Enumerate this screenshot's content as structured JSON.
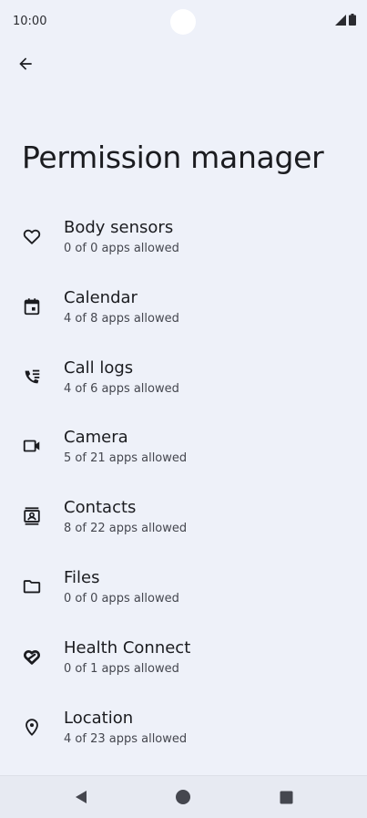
{
  "status": {
    "time": "10:00"
  },
  "header": {
    "title": "Permission manager"
  },
  "permissions": [
    {
      "label": "Body sensors",
      "summary": "0 of 0 apps allowed",
      "icon": "heart-icon"
    },
    {
      "label": "Calendar",
      "summary": "4 of 8 apps allowed",
      "icon": "calendar-icon"
    },
    {
      "label": "Call logs",
      "summary": "4 of 6 apps allowed",
      "icon": "call-log-icon"
    },
    {
      "label": "Camera",
      "summary": "5 of 21 apps allowed",
      "icon": "camera-icon"
    },
    {
      "label": "Contacts",
      "summary": "8 of 22 apps allowed",
      "icon": "contacts-icon"
    },
    {
      "label": "Files",
      "summary": "0 of 0 apps allowed",
      "icon": "folder-icon"
    },
    {
      "label": "Health Connect",
      "summary": "0 of 1 apps allowed",
      "icon": "health-connect-icon"
    },
    {
      "label": "Location",
      "summary": "4 of 23 apps allowed",
      "icon": "location-icon"
    }
  ],
  "colors": {
    "background": "#eef1f9",
    "icon": "#1b1c20",
    "secondary_text": "#45474f"
  }
}
